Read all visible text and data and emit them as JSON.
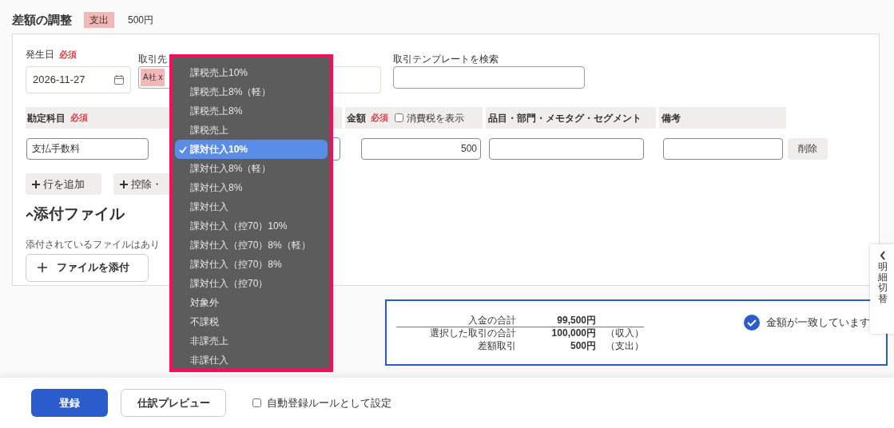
{
  "header": {
    "title": "差額の調整",
    "tag": "支出",
    "amount": "500円"
  },
  "form": {
    "date": {
      "label": "発生日",
      "required": "必須",
      "value": "2026-11-27"
    },
    "partner": {
      "label": "取引先",
      "chip": "A社 x"
    },
    "template": {
      "label": "取引テンプレートを検索"
    }
  },
  "table": {
    "columns": [
      {
        "label": "勘定科目",
        "required": "必須"
      },
      {
        "label": "金額",
        "required": "必須",
        "checkbox": {
          "label": "消費税を表示",
          "checked": false
        }
      },
      {
        "label": "品目・部門・メモタグ・セグメント"
      },
      {
        "label": "備考"
      }
    ],
    "row": {
      "account": "支払手数料",
      "amount": "500",
      "delete": "削除"
    }
  },
  "row_buttons": [
    "行を追加",
    "控除・"
  ],
  "attachments": {
    "title": "添付ファイル",
    "expanded": true,
    "empty_text": "添付されているファイルはあり",
    "add_button": "ファイルを添付"
  },
  "dropdown": {
    "options": [
      {
        "label": "課税売上10%",
        "selected": false
      },
      {
        "label": "課税売上8%（軽）",
        "selected": false
      },
      {
        "label": "課税売上8%",
        "selected": false
      },
      {
        "label": "課税売上",
        "selected": false
      },
      {
        "label": "課対仕入10%",
        "selected": true
      },
      {
        "label": "課対仕入8%（軽）",
        "selected": false
      },
      {
        "label": "課対仕入8%",
        "selected": false
      },
      {
        "label": "課対仕入",
        "selected": false
      },
      {
        "label": "課対仕入（控70）10%",
        "selected": false
      },
      {
        "label": "課対仕入（控70）8%（軽）",
        "selected": false
      },
      {
        "label": "課対仕入（控70）8%",
        "selected": false
      },
      {
        "label": "課対仕入（控70）",
        "selected": false
      },
      {
        "label": "対象外",
        "selected": false
      },
      {
        "label": "不課税",
        "selected": false
      },
      {
        "label": "非課売上",
        "selected": false
      },
      {
        "label": "非課仕入",
        "selected": false
      }
    ]
  },
  "summary": {
    "rows": [
      {
        "label": "入金の合計",
        "value": "99,500円"
      },
      {
        "label": "選択した取引の合計",
        "value": "100,000円",
        "note": "（収入）"
      },
      {
        "label": "差額取引",
        "value": "500円",
        "note": "（支出）"
      }
    ],
    "status": {
      "text": "金額が一致しています",
      "matched": true
    }
  },
  "side_tab": {
    "label": "明細切替"
  },
  "footer": {
    "submit": "登録",
    "preview": "仕訳プレビュー",
    "auto_rule": {
      "label": "自動登録ルールとして設定",
      "checked": false
    }
  }
}
